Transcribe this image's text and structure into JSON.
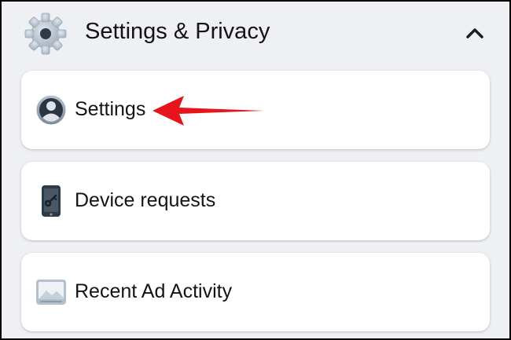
{
  "section": {
    "title": "Settings & Privacy",
    "icon": "gear-icon",
    "toggle_icon": "chevron-up-icon"
  },
  "items": [
    {
      "label": "Settings",
      "icon": "profile-icon"
    },
    {
      "label": "Device requests",
      "icon": "phone-key-icon"
    },
    {
      "label": "Recent Ad Activity",
      "icon": "image-icon"
    }
  ],
  "annotation": {
    "icon": "red-arrow-icon",
    "color": "#e8141b"
  },
  "colors": {
    "background": "#eef0f4",
    "card": "#ffffff",
    "text": "#141414"
  }
}
